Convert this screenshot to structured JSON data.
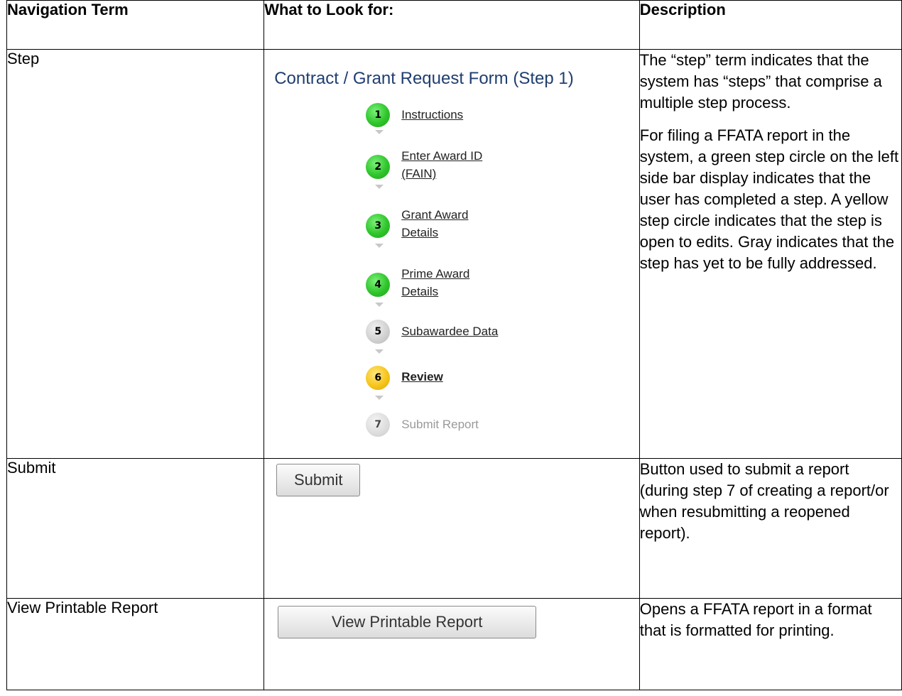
{
  "headers": [
    "Navigation Term",
    "What to Look for:",
    "Description"
  ],
  "rows": {
    "step": {
      "term": "Step",
      "form_title": "Contract / Grant Request Form (Step 1)",
      "steps": [
        {
          "num": "1",
          "label": "Instructions",
          "status": "complete"
        },
        {
          "num": "2",
          "label": "Enter Award ID\n(FAIN)",
          "status": "complete"
        },
        {
          "num": "3",
          "label": "Grant Award\nDetails",
          "status": "complete"
        },
        {
          "num": "4",
          "label": "Prime Award\nDetails",
          "status": "complete"
        },
        {
          "num": "5",
          "label": "Subawardee Data",
          "status": "not-addressed"
        },
        {
          "num": "6",
          "label": "Review",
          "status": "open"
        },
        {
          "num": "7",
          "label": "Submit Report",
          "status": "disabled"
        }
      ],
      "desc_p1": "The “step” term indicates that the system has “steps” that comprise a multiple step process.",
      "desc_p2": "For filing a FFATA report in the system, a green step circle on the left side bar display indicates that the user has completed a step. A yellow step circle indicates that the step is open to edits. Gray indicates that the step has yet to be fully addressed."
    },
    "submit": {
      "term": "Submit",
      "button": "Submit",
      "desc": "Button used to submit a report (during step 7 of creating a report/or when resubmitting a reopened report)."
    },
    "print": {
      "term": "View Printable Report",
      "button": "View Printable Report",
      "desc": "Opens a FFATA report in a format that is formatted for printing."
    }
  },
  "colors": {
    "complete": "#2fc52b",
    "open": "#f6c51b",
    "not_addressed": "#cfcfcf",
    "form_title": "#1f3e6f"
  }
}
